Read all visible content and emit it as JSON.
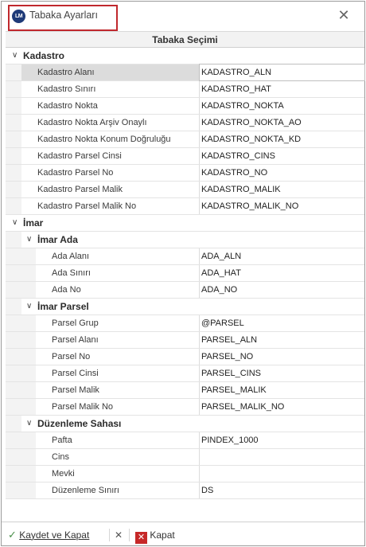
{
  "window": {
    "logo_text": "LM",
    "title": "Tabaka Ayarları",
    "close_glyph": "✕"
  },
  "grid": {
    "header": "Tabaka Seçimi",
    "kadastro": {
      "label": "Kadastro",
      "rows": [
        {
          "name": "Kadastro Alanı",
          "value": "KADASTRO_ALN"
        },
        {
          "name": "Kadastro Sınırı",
          "value": "KADASTRO_HAT"
        },
        {
          "name": "Kadastro Nokta",
          "value": "KADASTRO_NOKTA"
        },
        {
          "name": "Kadastro Nokta Arşiv Onaylı",
          "value": "KADASTRO_NOKTA_AO"
        },
        {
          "name": "Kadastro Nokta Konum Doğruluğu",
          "value": "KADASTRO_NOKTA_KD"
        },
        {
          "name": "Kadastro Parsel Cinsi",
          "value": "KADASTRO_CINS"
        },
        {
          "name": "Kadastro Parsel No",
          "value": "KADASTRO_NO"
        },
        {
          "name": "Kadastro Parsel Malik",
          "value": "KADASTRO_MALIK"
        },
        {
          "name": "Kadastro Parsel Malik No",
          "value": "KADASTRO_MALIK_NO"
        }
      ]
    },
    "imar": {
      "label": "İmar",
      "ada": {
        "label": "İmar Ada",
        "rows": [
          {
            "name": "Ada Alanı",
            "value": "ADA_ALN"
          },
          {
            "name": "Ada Sınırı",
            "value": "ADA_HAT"
          },
          {
            "name": "Ada No",
            "value": "ADA_NO"
          }
        ]
      },
      "parsel": {
        "label": "İmar Parsel",
        "rows": [
          {
            "name": "Parsel Grup",
            "value": "@PARSEL"
          },
          {
            "name": "Parsel Alanı",
            "value": "PARSEL_ALN"
          },
          {
            "name": "Parsel No",
            "value": "PARSEL_NO"
          },
          {
            "name": "Parsel Cinsi",
            "value": "PARSEL_CINS"
          },
          {
            "name": "Parsel Malik",
            "value": "PARSEL_MALIK"
          },
          {
            "name": "Parsel Malik No",
            "value": "PARSEL_MALIK_NO"
          }
        ]
      },
      "duzenleme": {
        "label": "Düzenleme Sahası",
        "rows": [
          {
            "name": "Pafta",
            "value": "PINDEX_1000"
          },
          {
            "name": "Cins",
            "value": ""
          },
          {
            "name": "Mevki",
            "value": ""
          },
          {
            "name": "Düzenleme Sınırı",
            "value": "DS"
          }
        ]
      }
    }
  },
  "toolbar": {
    "save_label": "Kaydet ve Kapat",
    "close_label": "Kapat",
    "check_glyph": "✓",
    "x_glyph": "✕",
    "red_x_glyph": "✕"
  },
  "colors": {
    "highlight_border": "#c0282d",
    "logo_bg": "#1e3a78",
    "close_icon_bg": "#c62828",
    "check_green": "#4a8f4a"
  }
}
